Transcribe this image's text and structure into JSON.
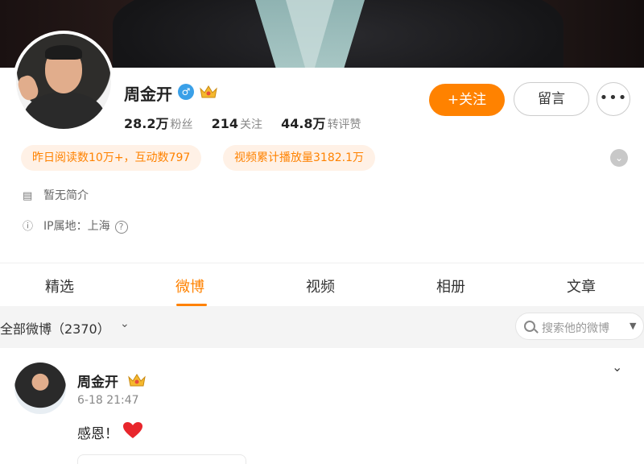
{
  "profile": {
    "name": "周金开",
    "gender_icon": "male-icon",
    "badge_icon": "crown-icon",
    "stats": [
      {
        "num": "28.2万",
        "label": "粉丝"
      },
      {
        "num": "214",
        "label": "关注"
      },
      {
        "num": "44.8万",
        "label": "转评赞"
      }
    ],
    "follow_label": "+关注",
    "message_label": "留言",
    "more_label": "•••",
    "tags": [
      "昨日阅读数10万+，互动数797",
      "视频累计播放量3182.1万"
    ],
    "bio": "暂无简介",
    "ip": "IP属地：上海",
    "help_glyph": "?",
    "bio_glyph": "▤",
    "ip_glyph": "ⓘ"
  },
  "tabs": [
    "精选",
    "微博",
    "视频",
    "相册",
    "文章"
  ],
  "active_tab": 1,
  "filter": {
    "label": "全部微博（2370）",
    "chevron": "⌄",
    "search_placeholder": "搜索他的微博",
    "search_caret": "▼"
  },
  "post": {
    "author": "周金开",
    "time": "6-18 21:47",
    "text": "感恩！",
    "menu_glyph": "⌄"
  },
  "colors": {
    "accent": "#ff8200",
    "tag_bg": "#fff1e6",
    "male": "#3aa0e8"
  }
}
